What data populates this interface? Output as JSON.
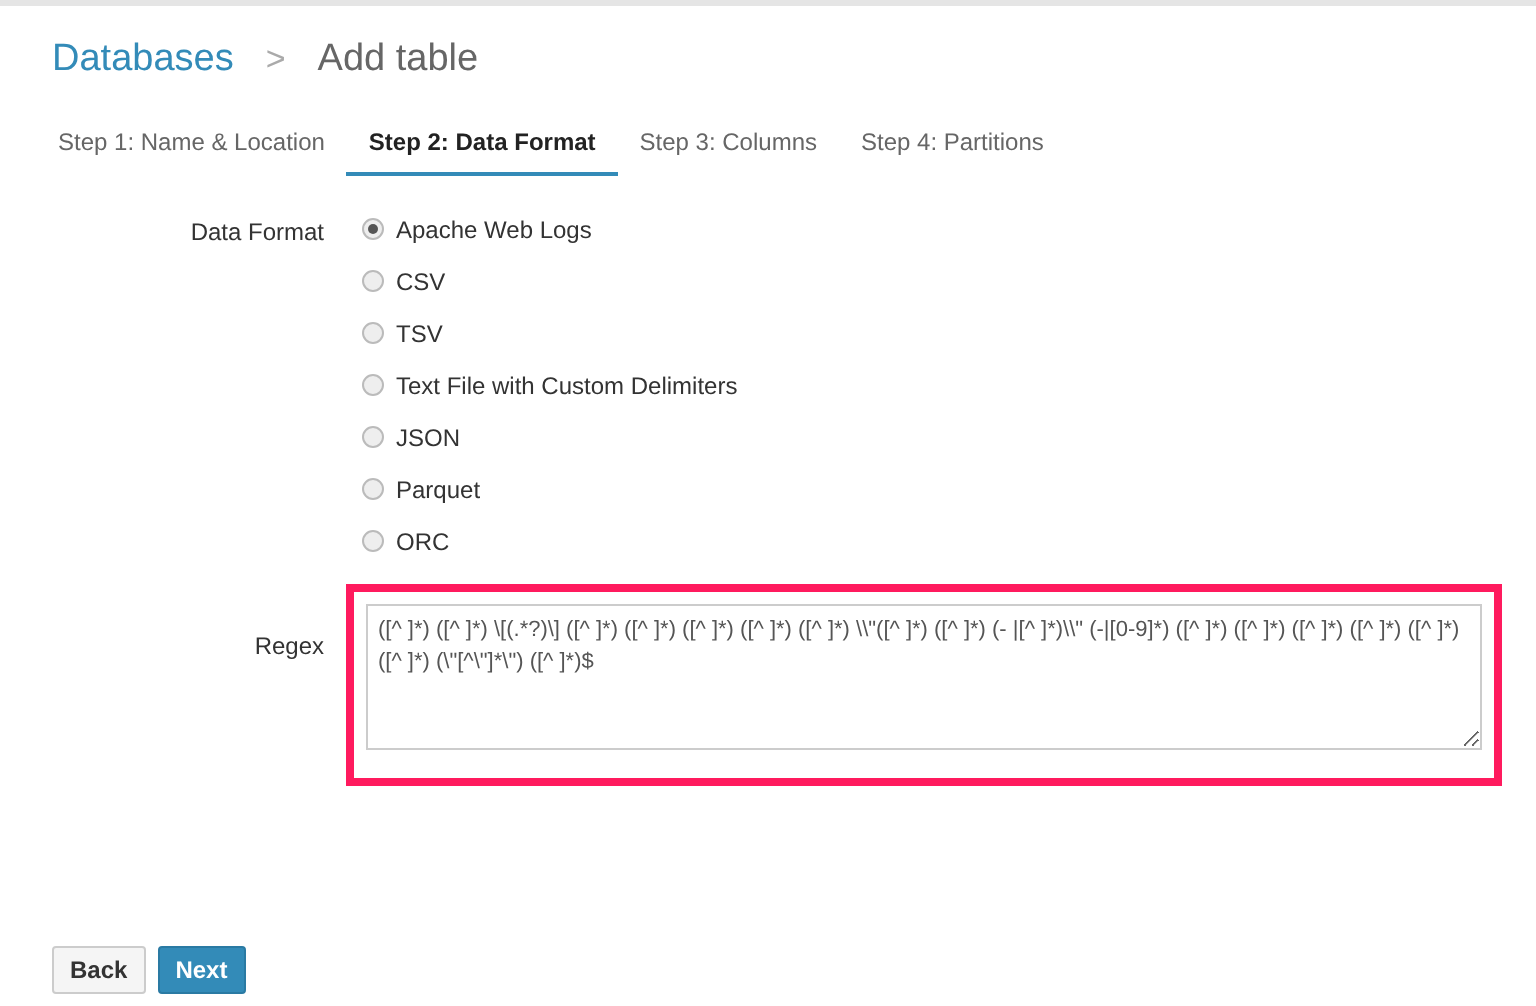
{
  "breadcrumb": {
    "parent": "Databases",
    "separator": ">",
    "current": "Add table"
  },
  "tabs": [
    {
      "label": "Step 1: Name & Location",
      "selected": false
    },
    {
      "label": "Step 2: Data Format",
      "selected": true
    },
    {
      "label": "Step 3: Columns",
      "selected": false
    },
    {
      "label": "Step 4: Partitions",
      "selected": false
    }
  ],
  "data_format": {
    "label": "Data Format",
    "options": [
      {
        "label": "Apache Web Logs",
        "selected": true
      },
      {
        "label": "CSV",
        "selected": false
      },
      {
        "label": "TSV",
        "selected": false
      },
      {
        "label": "Text File with Custom Delimiters",
        "selected": false
      },
      {
        "label": "JSON",
        "selected": false
      },
      {
        "label": "Parquet",
        "selected": false
      },
      {
        "label": "ORC",
        "selected": false
      }
    ]
  },
  "regex": {
    "label": "Regex",
    "value": "([^ ]*) ([^ ]*) \\[(.*?)\\] ([^ ]*) ([^ ]*) ([^ ]*) ([^ ]*) ([^ ]*) \\\\\"([^ ]*) ([^ ]*) (- |[^ ]*)\\\\\" (-|[0-9]*) ([^ ]*) ([^ ]*) ([^ ]*) ([^ ]*) ([^ ]*) ([^ ]*) (\\\"[^\\\"]*\\\") ([^ ]*)$",
    "highlighted": true
  },
  "buttons": [
    {
      "label": "Back",
      "kind": "secondary"
    },
    {
      "label": "Next",
      "kind": "primary"
    }
  ]
}
